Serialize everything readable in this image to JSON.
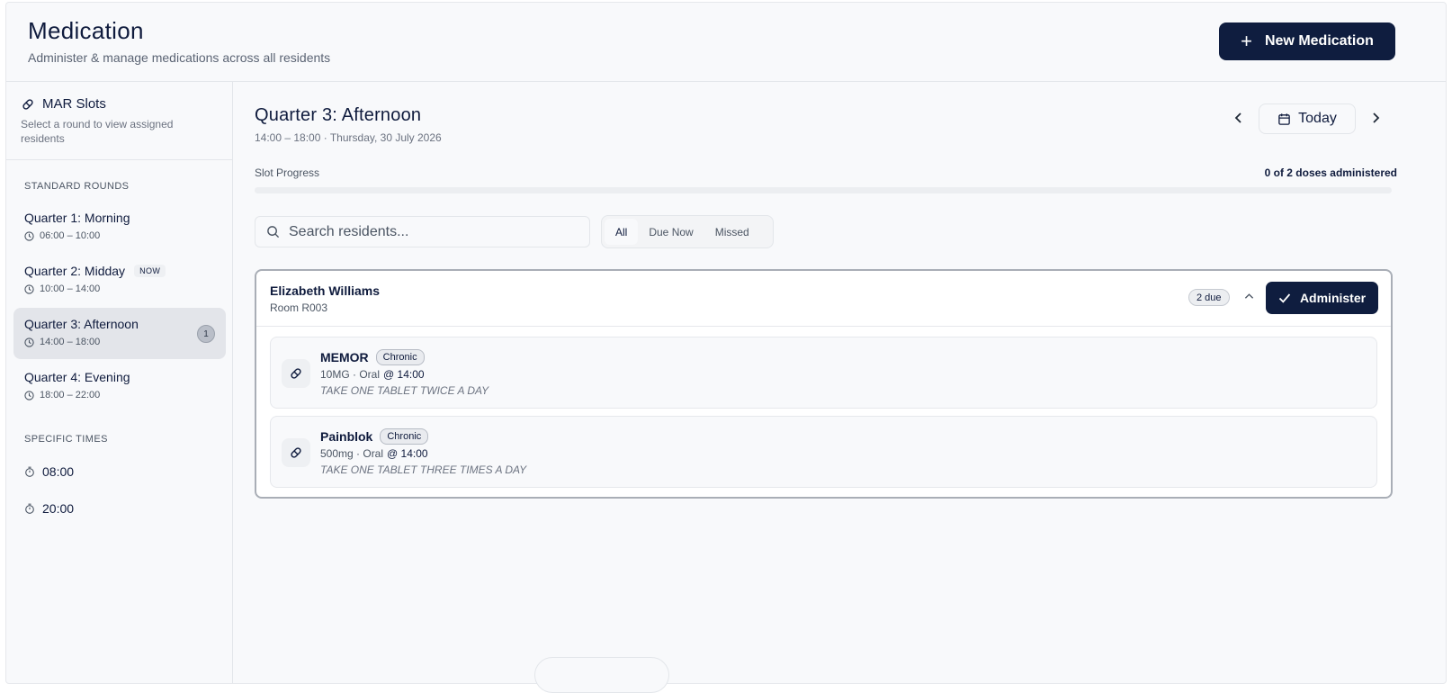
{
  "header": {
    "title": "Medication",
    "subtitle": "Administer & manage medications across all residents",
    "new_button": "New Medication"
  },
  "sidebar": {
    "title": "MAR Slots",
    "description": "Select a round to view assigned residents",
    "standard_label": "STANDARD ROUNDS",
    "rounds": [
      {
        "name": "Quarter 1: Morning",
        "time": "06:00 – 10:00"
      },
      {
        "name": "Quarter 2: Midday",
        "time": "10:00 – 14:00",
        "badge": "NOW"
      },
      {
        "name": "Quarter 3: Afternoon",
        "time": "14:00 – 18:00",
        "count": "1"
      },
      {
        "name": "Quarter 4: Evening",
        "time": "18:00 – 22:00"
      }
    ],
    "specific_label": "SPECIFIC TIMES",
    "specific_times": [
      "08:00",
      "20:00"
    ]
  },
  "main": {
    "slot_title": "Quarter 3: Afternoon",
    "slot_subtitle": "14:00 – 18:00 · Thursday, 30 July 2026",
    "today_label": "Today",
    "progress_label": "Slot Progress",
    "progress_text": "0 of 2 doses administered",
    "progress_fraction": 0,
    "search_placeholder": "Search residents...",
    "filters": [
      "All",
      "Due Now",
      "Missed"
    ],
    "active_filter": "All"
  },
  "resident": {
    "name": "Elizabeth Williams",
    "room": "Room R003",
    "due_badge": "2 due",
    "administer_label": "Administer",
    "medications": [
      {
        "name": "MEMOR",
        "tag": "Chronic",
        "dose": "10MG · Oral",
        "time": "@ 14:00",
        "instructions": "TAKE ONE TABLET TWICE A DAY"
      },
      {
        "name": "Painblok",
        "tag": "Chronic",
        "dose": "500mg · Oral",
        "time": "@ 14:00",
        "instructions": "TAKE ONE TABLET THREE TIMES A DAY"
      }
    ]
  },
  "colors": {
    "primary": "#0f1d3f",
    "background": "#f8f9fb",
    "active_round": "#e3e5ea"
  }
}
